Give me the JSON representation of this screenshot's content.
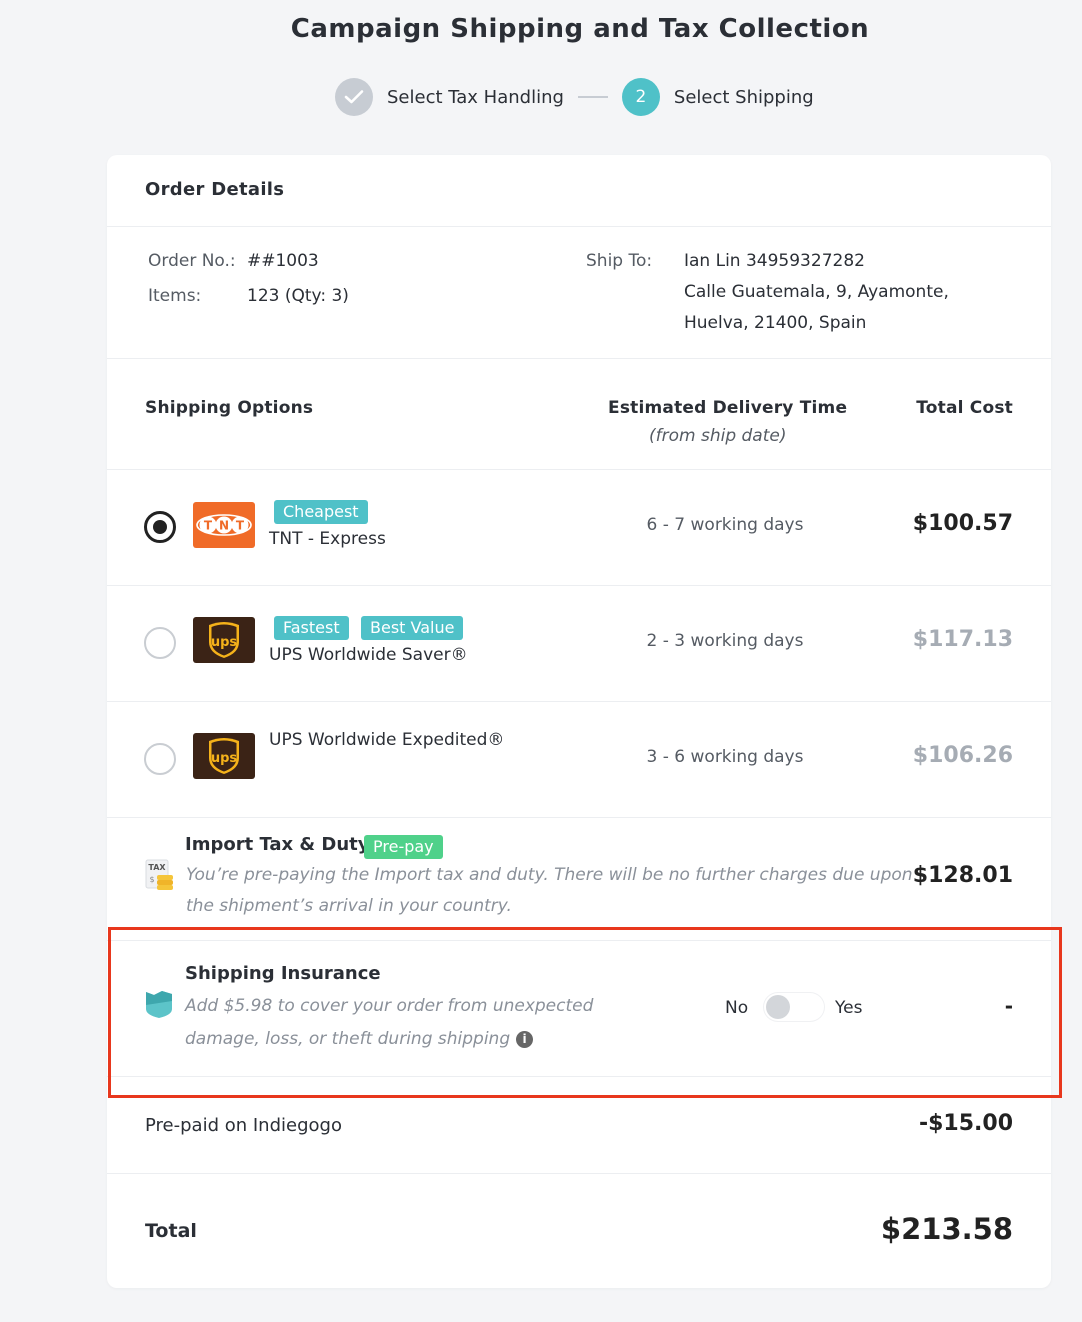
{
  "page": {
    "title": "Campaign Shipping and Tax Collection"
  },
  "stepper": {
    "step1_label": "Select Tax Handling",
    "step2_number": "2",
    "step2_label": "Select Shipping"
  },
  "order_details": {
    "header": "Order Details",
    "order_no_label": "Order No.:",
    "order_no": "##1003",
    "items_label": "Items:",
    "items": "123 (Qty: 3)",
    "ship_to_label": "Ship To:",
    "ship_to_line1": "Ian Lin 34959327282",
    "ship_to_line2": "Calle Guatemala, 9, Ayamonte,",
    "ship_to_line3": "Huelva, 21400, Spain"
  },
  "shipping_table": {
    "col_options": "Shipping Options",
    "col_delivery": "Estimated Delivery Time",
    "col_delivery_sub": "(from ship date)",
    "col_cost": "Total Cost"
  },
  "shipping_options": [
    {
      "name": "TNT - Express",
      "tags": [
        "Cheapest"
      ],
      "delivery": "6 - 7 working days",
      "price": "$100.57",
      "selected": true,
      "logo": "TNT"
    },
    {
      "name": "UPS Worldwide Saver®",
      "tags": [
        "Fastest",
        "Best Value"
      ],
      "delivery": "2 - 3 working days",
      "price": "$117.13",
      "selected": false,
      "logo": "ups"
    },
    {
      "name": "UPS Worldwide Expedited®",
      "tags": [],
      "delivery": "3 - 6 working days",
      "price": "$106.26",
      "selected": false,
      "logo": "ups"
    }
  ],
  "import_tax": {
    "title": "Import Tax & Duty",
    "badge": "Pre-pay",
    "icon_text": "TAX",
    "description": "You’re pre-paying the Import tax and duty. There will be no further charges due upon the shipment’s arrival in your country.",
    "price": "$128.01"
  },
  "insurance": {
    "title": "Shipping Insurance",
    "description": "Add $5.98 to cover your order from unexpected damage, loss, or theft during shipping",
    "toggle_no": "No",
    "toggle_yes": "Yes",
    "toggle_on": false,
    "price": "-"
  },
  "prepaid": {
    "label": "Pre-paid on Indiegogo",
    "amount": "-$15.00"
  },
  "total": {
    "label": "Total",
    "amount": "$213.58"
  },
  "colors": {
    "accent_teal": "#4fc1c8",
    "badge_green": "#4fd18a",
    "highlight_red": "#e8371d",
    "tnt_orange": "#f06b28",
    "ups_brown": "#3b2316"
  }
}
